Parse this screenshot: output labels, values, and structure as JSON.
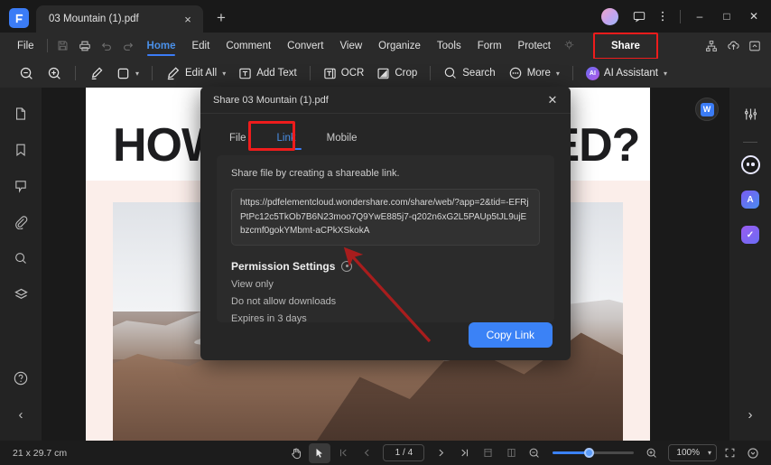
{
  "window": {
    "app_logo": "pdfelement-logo-icon",
    "tab_title": "03 Mountain (1).pdf",
    "tab_close": "×",
    "new_tab": "+",
    "minimize": "–",
    "maximize": "□",
    "close": "✕"
  },
  "menubar": {
    "items": [
      {
        "label": "File",
        "active": false
      },
      {
        "label": "Home",
        "active": true
      },
      {
        "label": "Edit",
        "active": false
      },
      {
        "label": "Comment",
        "active": false
      },
      {
        "label": "Convert",
        "active": false
      },
      {
        "label": "View",
        "active": false
      },
      {
        "label": "Organize",
        "active": false
      },
      {
        "label": "Tools",
        "active": false
      },
      {
        "label": "Form",
        "active": false
      },
      {
        "label": "Protect",
        "active": false
      }
    ],
    "share_label": "Share",
    "share_highlight_color": "#ee1c1c"
  },
  "toolbar": {
    "zoom_out": "zoom-out-icon",
    "zoom_in": "zoom-in-icon",
    "highlight": "highlighter-icon",
    "shape": "shape-icon",
    "edit_all": "Edit All",
    "add_text": "Add Text",
    "ocr": "OCR",
    "crop": "Crop",
    "search": "Search",
    "more": "More",
    "ai_assistant": "AI Assistant",
    "ai_badge": "AI"
  },
  "left_rail": {
    "items": [
      {
        "name": "thumbnails-icon"
      },
      {
        "name": "bookmark-icon"
      },
      {
        "name": "comment-icon"
      },
      {
        "name": "attachment-icon"
      },
      {
        "name": "search-icon"
      },
      {
        "name": "layers-icon"
      }
    ],
    "help": "help-icon",
    "collapse": "‹"
  },
  "right_rail": {
    "properties": "sliders-icon",
    "chat": "chat-bot-icon",
    "ai_translate_badge": "A",
    "ai_check_badge": "✓",
    "expand": "›"
  },
  "document": {
    "title_text": "HOW                                        IED?",
    "title_visible_left": "HOW",
    "title_visible_right": "IED?",
    "word_badge": "W"
  },
  "dialog": {
    "title": "Share 03 Mountain (1).pdf",
    "close": "✕",
    "tabs": [
      {
        "label": "File",
        "active": false
      },
      {
        "label": "Link",
        "active": true
      },
      {
        "label": "Mobile",
        "active": false
      }
    ],
    "tab_highlight_color": "#ee1c1c",
    "hint": "Share file by creating a shareable link.",
    "url": "https://pdfelementcloud.wondershare.com/share/web/?app=2&tid=-EFRjPtPc12c5TkOb7B6N23moo7Q9YwE885j7-q202n6xG2L5PAUp5tJL9ujEbzcmf0gokYMbmt-aCPkXSkokA",
    "permission_title": "Permission Settings",
    "permission_info_icon": "info-icon",
    "permissions": [
      "View only",
      "Do not allow downloads",
      "Expires in 3 days"
    ],
    "copy_label": "Copy Link",
    "copy_color": "#3b82f6",
    "arrow_color": "#a81d1d"
  },
  "statusbar": {
    "page_size": "21 x 29.7 cm",
    "hand_tool": "hand-icon",
    "select_tool": "select-icon",
    "first_page": "⏮",
    "prev_page": "‹",
    "page_indicator": "1 / 4",
    "next_page": "›",
    "last_page": "⏭",
    "single_page": "single-page-icon",
    "facing_page": "facing-page-icon",
    "zoom_out": "zoom-out-icon",
    "zoom_in": "zoom-in-icon",
    "zoom_level": "100%",
    "fit_screen": "fit-screen-icon",
    "more_view": "more-view-icon"
  }
}
